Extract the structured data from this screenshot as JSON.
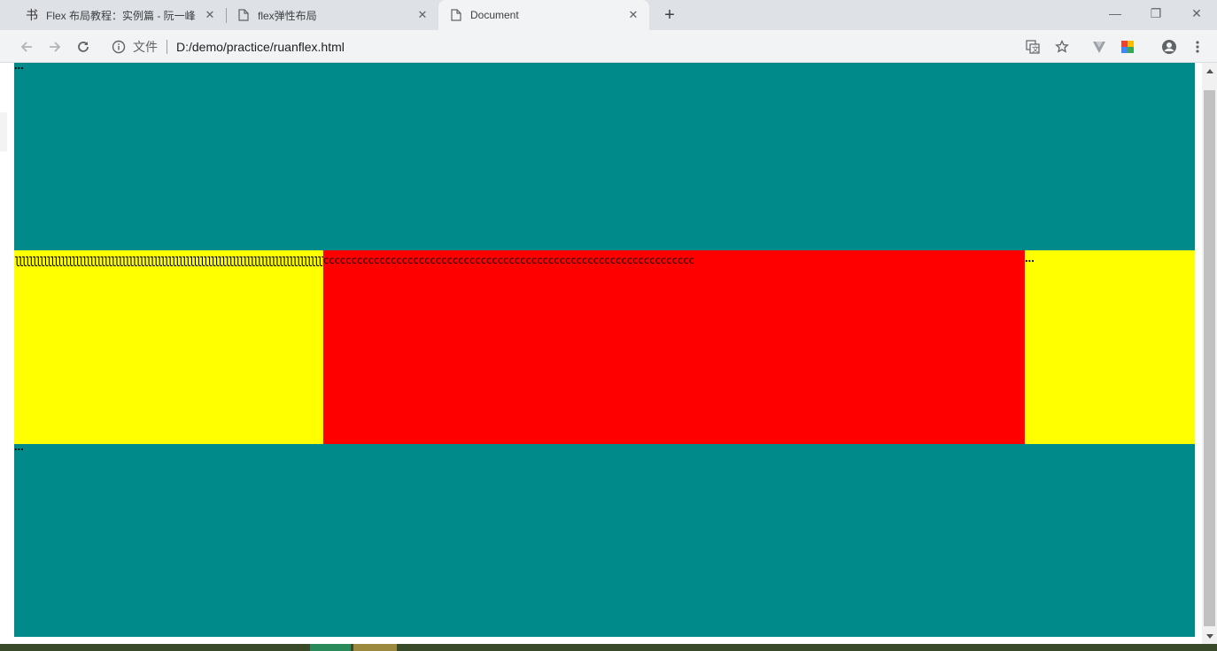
{
  "browser": {
    "tabs": [
      {
        "title": "Flex 布局教程：实例篇 - 阮一峰",
        "favicon": "ruanyifeng-logo-icon",
        "close": "✕"
      },
      {
        "title": "flex弹性布局",
        "favicon": "page-icon",
        "close": "✕"
      },
      {
        "title": "Document",
        "favicon": "page-icon",
        "close": "✕",
        "active": true
      }
    ],
    "new_tab": "+",
    "window_controls": {
      "minimize": "—",
      "restore": "❐",
      "close": "✕"
    },
    "omnibox": {
      "scheme_label": "文件",
      "url": "D:/demo/practice/ruanflex.html"
    },
    "toolbar_icons": [
      "back-icon",
      "forward-icon",
      "reload-icon",
      "translate-icon",
      "star-icon",
      "extension-v-icon",
      "extension-color-icon",
      "profile-icon",
      "menu-icon"
    ]
  },
  "page": {
    "colors": {
      "teal": "#008b8b",
      "yellow": "#ffff00",
      "red": "#ff0000"
    },
    "top_block_text": "...",
    "left_cell_text": "lllllllllllllllllllllllllllllllllllllllllllllllllllllllllllllllllllllllllllllllllllllllllll",
    "center_cell_text": "cccccccccccccccccccccccccccccccccccccccccccccccccccccccccccccccccc",
    "right_cell_text": "...",
    "bottom_block_text": "..."
  }
}
